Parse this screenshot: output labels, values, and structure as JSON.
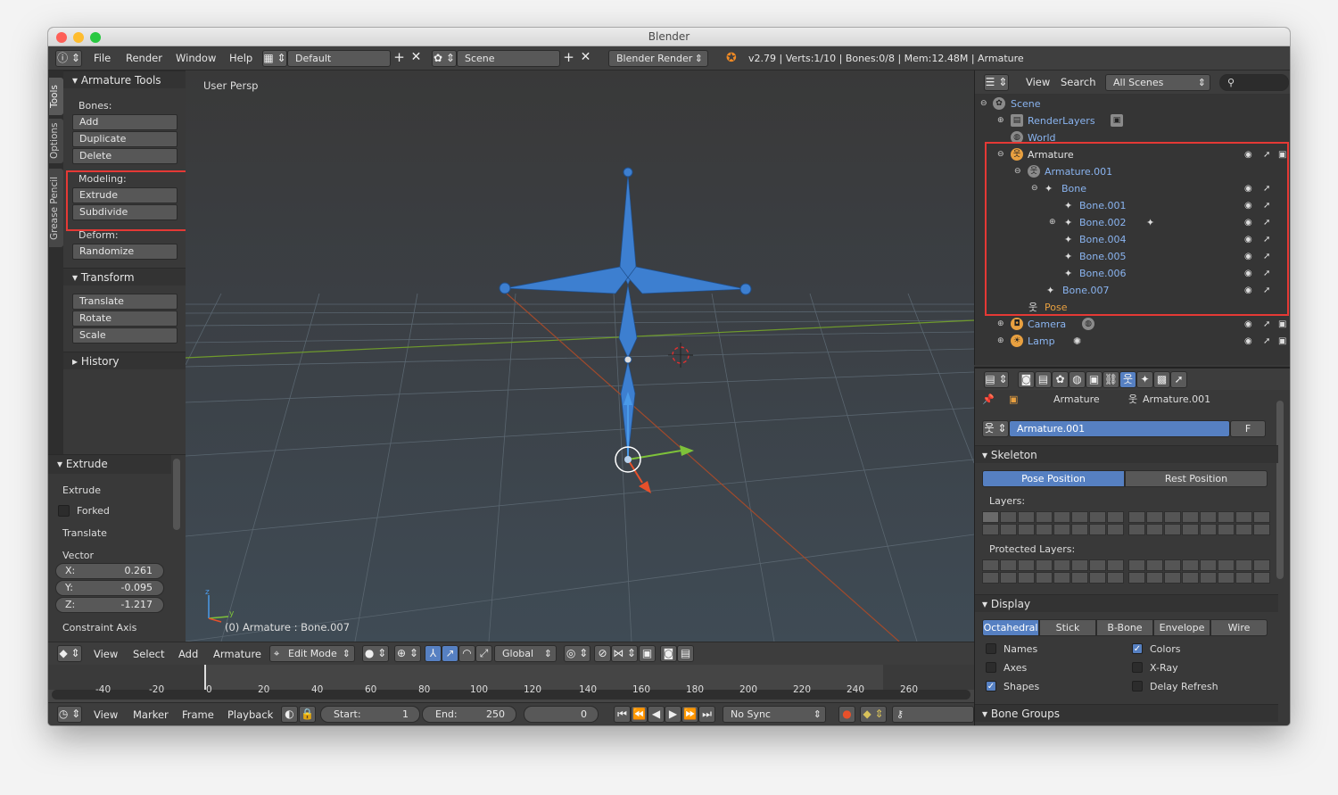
{
  "window": {
    "title": "Blender"
  },
  "topbar": {
    "menus": [
      "File",
      "Render",
      "Window",
      "Help"
    ],
    "layout": "Default",
    "scene": "Scene",
    "engine": "Blender Render",
    "stats": "v2.79 | Verts:1/10 | Bones:0/8 | Mem:12.48M | Armature"
  },
  "tool_tabs": [
    "Tools",
    "Options",
    "Grease Pencil"
  ],
  "tool_shelf": {
    "panel1": "Armature Tools",
    "bones_label": "Bones:",
    "bones_buttons": [
      "Add",
      "Duplicate",
      "Delete"
    ],
    "modeling_label": "Modeling:",
    "modeling_buttons": [
      "Extrude",
      "Subdivide"
    ],
    "deform_label": "Deform:",
    "deform_buttons": [
      "Randomize"
    ],
    "panel2": "Transform",
    "transform_buttons": [
      "Translate",
      "Rotate",
      "Scale"
    ],
    "panel3": "History"
  },
  "operator": {
    "title": "Extrude",
    "op_label": "Extrude",
    "forked_label": "Forked",
    "translate_label": "Translate",
    "vector_label": "Vector",
    "x_label": "X:",
    "x_value": "0.261",
    "y_label": "Y:",
    "y_value": "-0.095",
    "z_label": "Z:",
    "z_value": "-1.217",
    "constraint_label": "Constraint Axis"
  },
  "viewport": {
    "view_name": "User Persp",
    "status": "(0) Armature : Bone.007",
    "axis_z": "z",
    "axis_y": "y"
  },
  "view_header": {
    "menus": [
      "View",
      "Select",
      "Add",
      "Armature"
    ],
    "mode": "Edit Mode",
    "orientation": "Global"
  },
  "timeline": {
    "ticks": [
      "-40",
      "-20",
      "0",
      "20",
      "40",
      "60",
      "80",
      "100",
      "120",
      "140",
      "160",
      "180",
      "200",
      "220",
      "240",
      "260"
    ]
  },
  "timeline_bar": {
    "menus": [
      "View",
      "Marker",
      "Frame",
      "Playback"
    ],
    "start_label": "Start:",
    "start_value": "1",
    "end_label": "End:",
    "end_value": "250",
    "current_frame": "0",
    "sync": "No Sync"
  },
  "outliner": {
    "menus": [
      "View",
      "Search"
    ],
    "filter": "All Scenes",
    "items": {
      "scene": "Scene",
      "renderlayers": "RenderLayers",
      "world": "World",
      "armature": "Armature",
      "armature001": "Armature.001",
      "bone": "Bone",
      "bone001": "Bone.001",
      "bone002": "Bone.002",
      "bone004": "Bone.004",
      "bone005": "Bone.005",
      "bone006": "Bone.006",
      "bone007": "Bone.007",
      "pose": "Pose",
      "camera": "Camera",
      "lamp": "Lamp"
    }
  },
  "properties": {
    "breadcrumb_object": "Armature",
    "breadcrumb_data": "Armature.001",
    "datablock": "Armature.001",
    "fake_user": "F",
    "skeleton": {
      "title": "Skeleton",
      "pose_position": "Pose Position",
      "rest_position": "Rest Position",
      "layers_label": "Layers:",
      "protected_label": "Protected Layers:"
    },
    "display": {
      "title": "Display",
      "types": [
        "Octahedral",
        "Stick",
        "B-Bone",
        "Envelope",
        "Wire"
      ],
      "names": "Names",
      "colors": "Colors",
      "axes": "Axes",
      "xray": "X-Ray",
      "shapes": "Shapes",
      "delay": "Delay Refresh"
    },
    "bone_groups": {
      "title": "Bone Groups"
    }
  },
  "colors": {
    "accent": "#5680c2",
    "highlight": "#e53935",
    "bone": "#3d7fd0",
    "outliner_text": "#8ab4f0"
  }
}
